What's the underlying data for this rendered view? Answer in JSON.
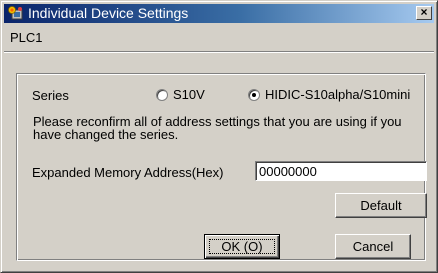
{
  "window": {
    "title": "Individual Device Settings",
    "close_glyph": "×"
  },
  "device": {
    "name": "PLC1"
  },
  "series": {
    "label": "Series",
    "options": [
      {
        "label": "S10V",
        "selected": false
      },
      {
        "label": "HIDIC-S10alpha/S10mini",
        "selected": true
      }
    ]
  },
  "note": "Please reconfirm all of address settings that you are using if you have changed the series.",
  "memory": {
    "label": "Expanded Memory Address(Hex)",
    "value": "00000000"
  },
  "buttons": {
    "default_label": "Default",
    "ok_label": "OK (O)",
    "cancel_label": "Cancel"
  },
  "icons": {
    "title": "device-settings-icon",
    "close": "close-icon"
  },
  "colors": {
    "titlebar_start": "#0a246a",
    "titlebar_end": "#a6caf0",
    "face": "#d4d0c8"
  }
}
